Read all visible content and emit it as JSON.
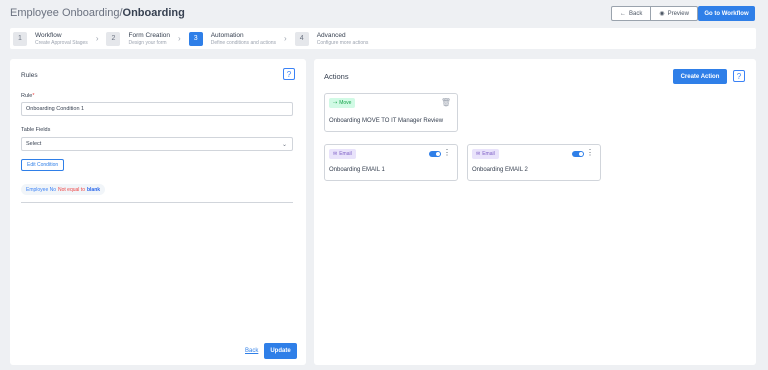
{
  "header": {
    "title_prefix": "Employee Onboarding/",
    "title_strong": "Onboarding",
    "back_label": "Back",
    "preview_label": "Preview",
    "goto_label": "Go to Workflow"
  },
  "steps": [
    {
      "num": "1",
      "title": "Workflow",
      "subtitle": "Create Approval Stages"
    },
    {
      "num": "2",
      "title": "Form Creation",
      "subtitle": "Design your form"
    },
    {
      "num": "3",
      "title": "Automation",
      "subtitle": "Define conditions and actions"
    },
    {
      "num": "4",
      "title": "Advanced",
      "subtitle": "Configure more actions"
    }
  ],
  "rules": {
    "title": "Rules",
    "help": "?",
    "rule_label": "Rule",
    "required_mark": "*",
    "rule_value": "Onboarding Condition 1",
    "table_fields_label": "Table Fields",
    "select_value": "Select",
    "edit_condition": "Edit Condition",
    "condition": {
      "field": "Employee No",
      "operator": "Not equal to",
      "value": "blank"
    },
    "back_label": "Back",
    "update_label": "Update"
  },
  "actions": {
    "title": "Actions",
    "help": "?",
    "create_label": "Create Action",
    "cards": [
      {
        "tag": "Move",
        "text": "Onboarding MOVE TO IT Manager Review"
      },
      {
        "tag": "Email",
        "text": "Onboarding EMAIL 1",
        "enabled": true
      },
      {
        "tag": "Email",
        "text": "Onboarding EMAIL 2",
        "enabled": true
      }
    ]
  },
  "colors": {
    "accent": "#2f7fe8",
    "move_tag": "#16a34a",
    "email_tag": "#7c5cc4",
    "error": "#ef4444"
  }
}
